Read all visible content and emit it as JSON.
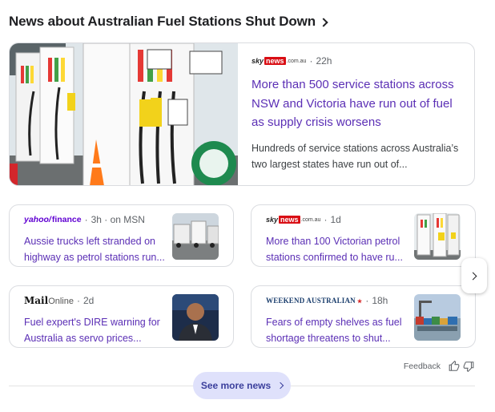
{
  "header": {
    "title": "News about Australian Fuel Stations Shut Down"
  },
  "featured": {
    "source_logo": "sky news .com.au",
    "time": "22h",
    "title": "More than 500 service stations across NSW and Victoria have run out of fuel as supply crisis worsens",
    "snippet": "Hundreds of service stations across Australia’s two largest states have run out of..."
  },
  "articles": [
    {
      "source_logo": "yahoo/finance",
      "meta": "3h · on MSN",
      "title": "Aussie trucks left stranded on highway as petrol stations run...",
      "thumb_icon": "trucks-photo-icon"
    },
    {
      "source_logo": "sky news .com.au",
      "meta": "1d",
      "title": "More than 100 Victorian petrol stations confirmed to have ru...",
      "thumb_icon": "fuel-pumps-photo-icon"
    },
    {
      "source_logo": "MailOnline",
      "meta": "2d",
      "title": "Fuel expert's DIRE warning for Australia as servo prices...",
      "thumb_icon": "person-photo-icon"
    },
    {
      "source_logo": "WEEKEND AUSTRALIAN",
      "meta": "18h",
      "title": "Fears of empty shelves as fuel shortage threatens to shut...",
      "thumb_icon": "port-photo-icon"
    }
  ],
  "feedback": {
    "label": "Feedback"
  },
  "see_more": {
    "label": "See more news"
  },
  "colors": {
    "title_link": "#5b2fb5",
    "see_more_bg": "#dfe1fb",
    "sky_red": "#d90e14",
    "yahoo_purple": "#6001d2"
  }
}
